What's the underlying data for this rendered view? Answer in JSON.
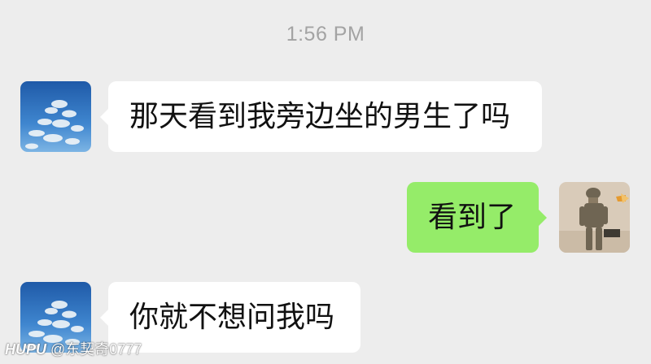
{
  "timestamp": "1:56 PM",
  "messages": [
    {
      "sender": "other",
      "text": "那天看到我旁边坐的男生了吗"
    },
    {
      "sender": "me",
      "text": "看到了"
    },
    {
      "sender": "other",
      "text": "你就不想问我吗"
    }
  ],
  "avatars": {
    "other": "sky-clouds-avatar",
    "me": "soldier-avatar"
  },
  "watermark": {
    "brand": "HUPU",
    "handle": "@东契奇0777"
  },
  "colors": {
    "background": "#ededed",
    "incoming_bubble": "#ffffff",
    "outgoing_bubble": "#95ec69",
    "timestamp": "#a3a3a3"
  }
}
